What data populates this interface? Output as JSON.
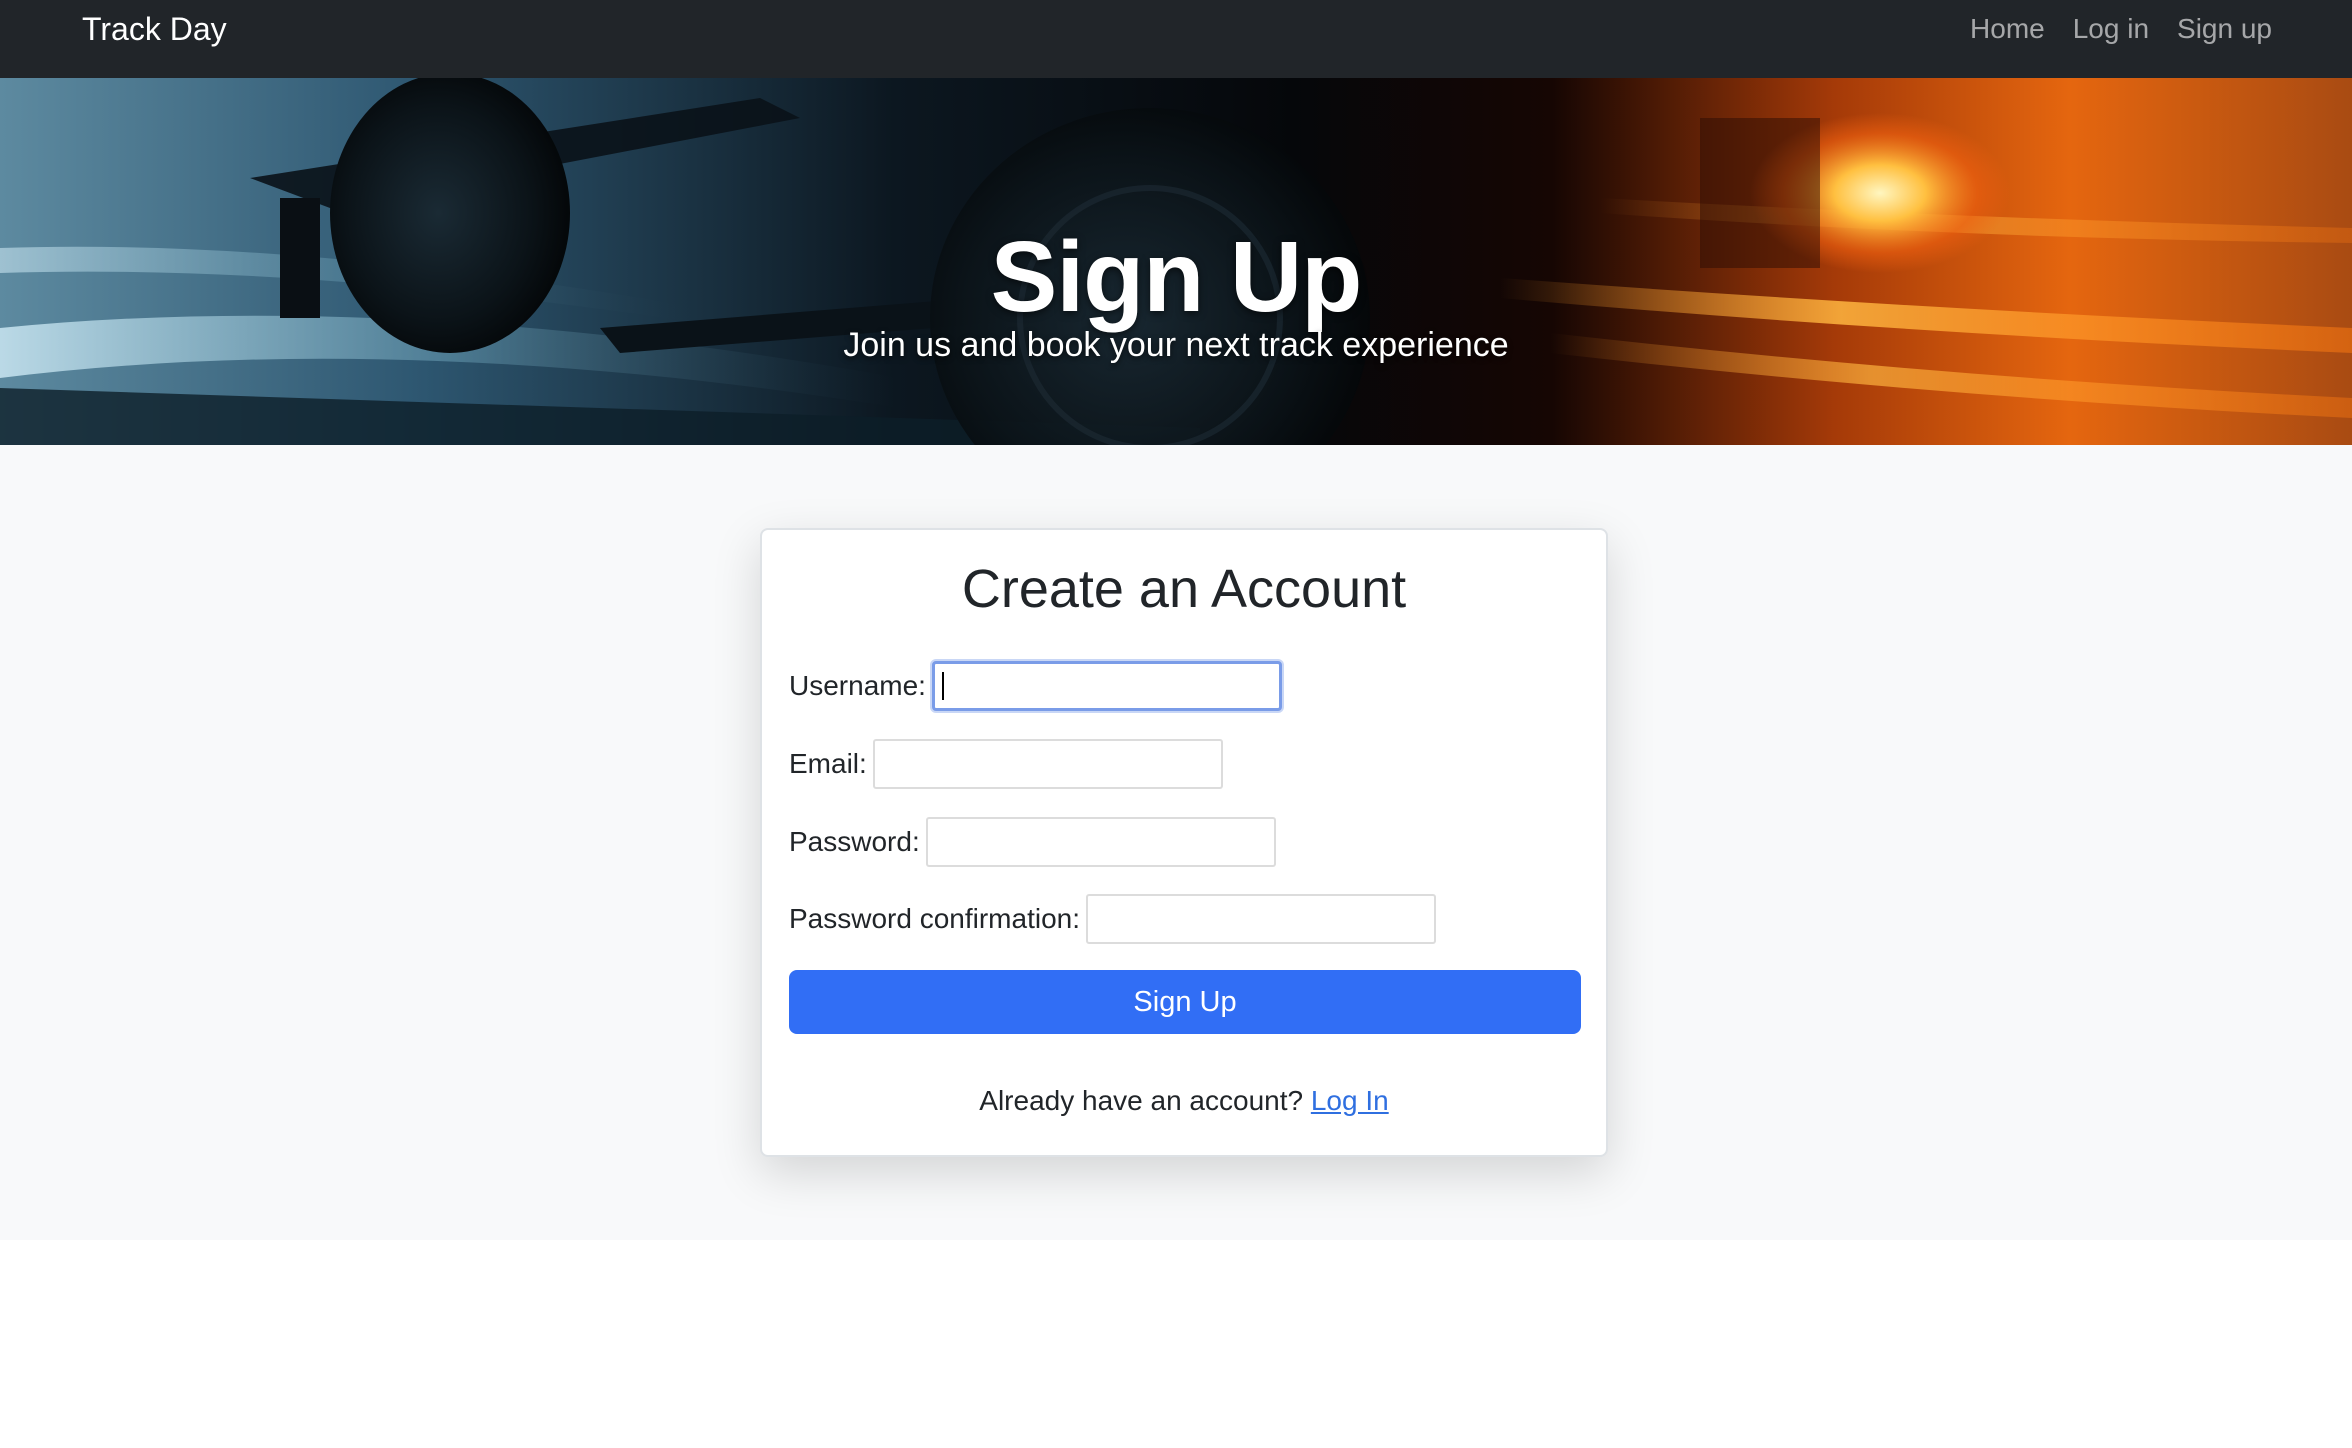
{
  "navbar": {
    "brand": "Track Day",
    "links": [
      "Home",
      "Log in",
      "Sign up"
    ]
  },
  "hero": {
    "title": "Sign Up",
    "subtitle": "Join us and book your next track experience"
  },
  "form": {
    "heading": "Create an Account",
    "fields": {
      "username_label": "Username:",
      "username_value": "",
      "email_label": "Email:",
      "email_value": "",
      "password_label": "Password:",
      "password_value": "",
      "password_confirmation_label": "Password confirmation:",
      "password_confirmation_value": ""
    },
    "submit_label": "Sign Up",
    "login_prompt": "Already have an account?",
    "login_link": "Log In"
  },
  "colors": {
    "navbar_bg": "#212529",
    "primary_button": "#316ef5",
    "link": "#2f6fe0",
    "page_bg": "#f8f9fa"
  }
}
